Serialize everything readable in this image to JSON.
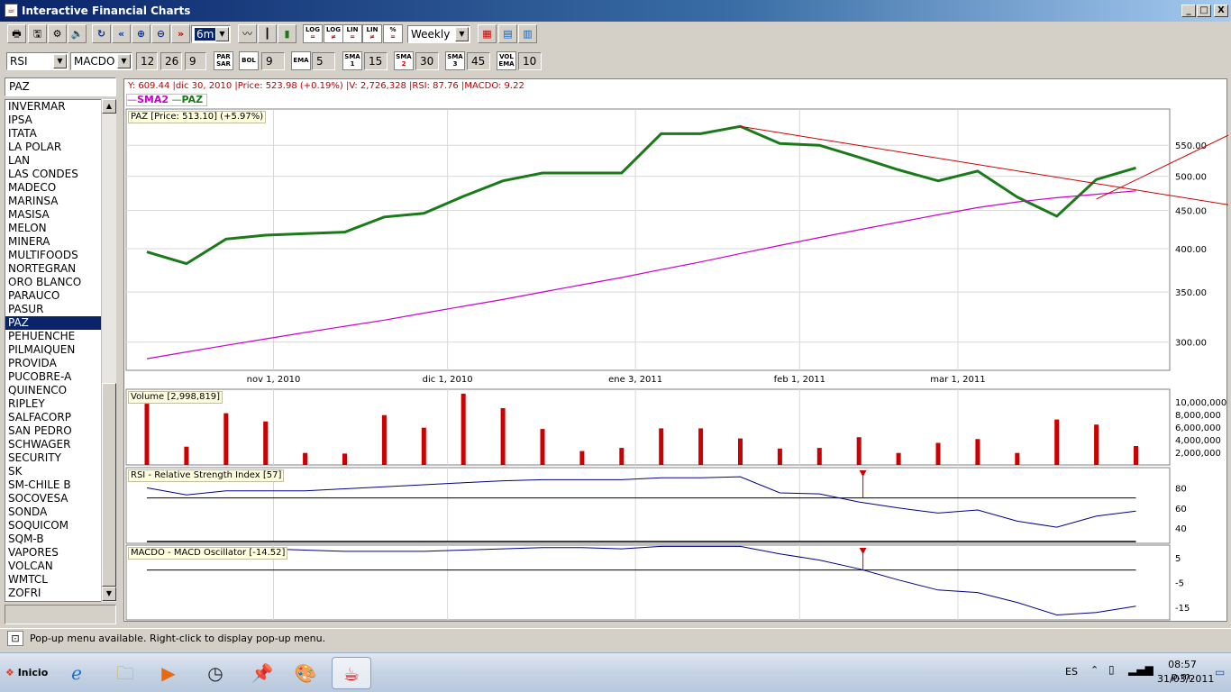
{
  "window": {
    "title": "Interactive Financial Charts",
    "minimize": "_",
    "maximize": "□",
    "close": "X"
  },
  "toolbar1": {
    "period_value": "6m",
    "interval_value": "Weekly",
    "buttons": [
      "print",
      "save",
      "settings",
      "sound",
      "refresh",
      "back-fast",
      "zoom-in",
      "zoom-out",
      "forward-fast"
    ],
    "chart_types": [
      "line-chart",
      "bar-chart",
      "candle-chart"
    ],
    "scale_buttons": [
      {
        "top": "LOG",
        "bottom": "="
      },
      {
        "top": "LOG",
        "bottom": "≠"
      },
      {
        "top": "LIN",
        "bottom": "="
      },
      {
        "top": "LIN",
        "bottom": "≠"
      },
      {
        "top": "%",
        "bottom": "="
      }
    ],
    "color_buttons": [
      "color-palette",
      "chart-style",
      "chart-layout"
    ]
  },
  "toolbar2": {
    "indicator1": "RSI",
    "indicator2": "MACDO",
    "macd_params": [
      "12",
      "26",
      "9"
    ],
    "params": [
      {
        "top": "PAR",
        "bottom": "SAR",
        "value": ""
      },
      {
        "top": "BOL",
        "bottom": "",
        "value": "9"
      },
      {
        "top": "EMA",
        "bottom": "",
        "value": "5"
      },
      {
        "top": "SMA",
        "bottom": "1",
        "value": "15"
      },
      {
        "top": "SMA",
        "bottom": "2",
        "value": "30"
      },
      {
        "top": "SMA",
        "bottom": "3",
        "value": "45"
      },
      {
        "top": "VOL",
        "bottom": "EMA",
        "value": "10"
      }
    ]
  },
  "symbol_field": "PAZ",
  "symbols": [
    "INVERMAR",
    "IPSA",
    "ITATA",
    "LA POLAR",
    "LAN",
    "LAS CONDES",
    "MADECO",
    "MARINSA",
    "MASISA",
    "MELON",
    "MINERA",
    "MULTIFOODS",
    "NORTEGRAN",
    "ORO BLANCO",
    "PARAUCO",
    "PASUR",
    "PAZ",
    "PEHUENCHE",
    "PILMAIQUEN",
    "PROVIDA",
    "PUCOBRE-A",
    "QUINENCO",
    "RIPLEY",
    "SALFACORP",
    "SAN PEDRO",
    "SCHWAGER",
    "SECURITY",
    "SK",
    "SM-CHILE B",
    "SOCOVESA",
    "SONDA",
    "SOQUICOM",
    "SQM-B",
    "VAPORES",
    "VOLCAN",
    "WMTCL",
    "ZOFRI"
  ],
  "selected_symbol": "PAZ",
  "info_line": "Y: 609.44 |dic 30, 2010 |Price: 523.98 (+0.19%) |V: 2,726,328 |RSI: 87.76 |MACDO: 9.22",
  "legend": [
    {
      "name": "SMA2",
      "color": "#cc00cc"
    },
    {
      "name": "PAZ",
      "color": "#1a7a1a"
    }
  ],
  "chart_data": [
    {
      "type": "line",
      "title": "PAZ [Price: 513.10] (+5.97%)",
      "x_tick_labels": [
        "nov 1, 2010",
        "dic 1, 2010",
        "ene 3, 2011",
        "feb 1, 2011",
        "mar 1, 2011"
      ],
      "y_tick_labels": [
        "300.00",
        "350.00",
        "400.00",
        "450.00",
        "500.00",
        "550.00"
      ],
      "y_scale": "log",
      "ylim": [
        275,
        615
      ],
      "series": [
        {
          "name": "PAZ",
          "color": "#1a7a1a",
          "values": [
            396,
            382,
            412,
            417,
            419,
            421,
            441,
            446,
            470,
            493,
            505,
            505,
            505,
            570,
            570,
            583,
            553,
            550,
            530,
            510,
            493,
            508,
            469,
            442,
            495,
            513
          ]
        },
        {
          "name": "SMA2",
          "color": "#cc00cc",
          "values": [
            285,
            291,
            297,
            303,
            309,
            315,
            321,
            328,
            335,
            342,
            350,
            358,
            366,
            375,
            384,
            394,
            404,
            414,
            424,
            434,
            444,
            454,
            462,
            468,
            473,
            478
          ]
        }
      ],
      "trendlines": [
        {
          "color": "#cc0000",
          "from": {
            "week": 15,
            "value": 583
          },
          "to": {
            "week": 28,
            "value": 452
          }
        },
        {
          "color": "#cc0000",
          "from": {
            "week": 24,
            "value": 466
          },
          "to": {
            "week": 28,
            "value": 590
          }
        }
      ]
    },
    {
      "type": "bar",
      "title": "Volume [2,998,819]",
      "y_tick_labels": [
        "2,000,000",
        "4,000,000",
        "6,000,000",
        "8,000,000",
        "10,000,000"
      ],
      "ylim": [
        0,
        12000000
      ],
      "color": "#cc0000",
      "values": [
        9700000,
        2900000,
        8200000,
        6900000,
        1900000,
        1800000,
        7900000,
        5900000,
        11300000,
        9000000,
        5700000,
        2200000,
        2700000,
        5800000,
        5800000,
        4200000,
        2600000,
        2700000,
        4400000,
        1900000,
        3500000,
        4100000,
        1900000,
        7200000,
        6400000,
        3000000
      ]
    },
    {
      "type": "line",
      "title": "RSI - Relative Strength Index [57]",
      "y_tick_labels": [
        "40",
        "60",
        "80"
      ],
      "ylim": [
        25,
        100
      ],
      "reference_line": 70,
      "color": "#00008b",
      "values": [
        80,
        73,
        77,
        77,
        77,
        79,
        81,
        83,
        85,
        87,
        88,
        88,
        88,
        90,
        90,
        91,
        75,
        74,
        66,
        60,
        55,
        58,
        47,
        41,
        52,
        57
      ]
    },
    {
      "type": "line",
      "title": "MACDO - MACD Oscillator [-14.52]",
      "y_tick_labels": [
        "5",
        "-5",
        "-15"
      ],
      "ylim": [
        -20,
        10
      ],
      "reference_line": 0,
      "color": "#00008b",
      "values": [
        9,
        8,
        8.5,
        8.5,
        8,
        7.5,
        7.5,
        7.5,
        8,
        8.5,
        9,
        9,
        8.5,
        9.5,
        9.5,
        9.5,
        6.5,
        4,
        0.5,
        -4,
        -8,
        -9,
        -13,
        -18,
        -17,
        -14.5
      ]
    }
  ],
  "status_text": "Pop-up menu available. Right-click to display pop-up menu.",
  "taskbar": {
    "start_label": "Inicio",
    "language": "ES",
    "time": "08:57 p.m.",
    "date": "31/03/2011"
  }
}
